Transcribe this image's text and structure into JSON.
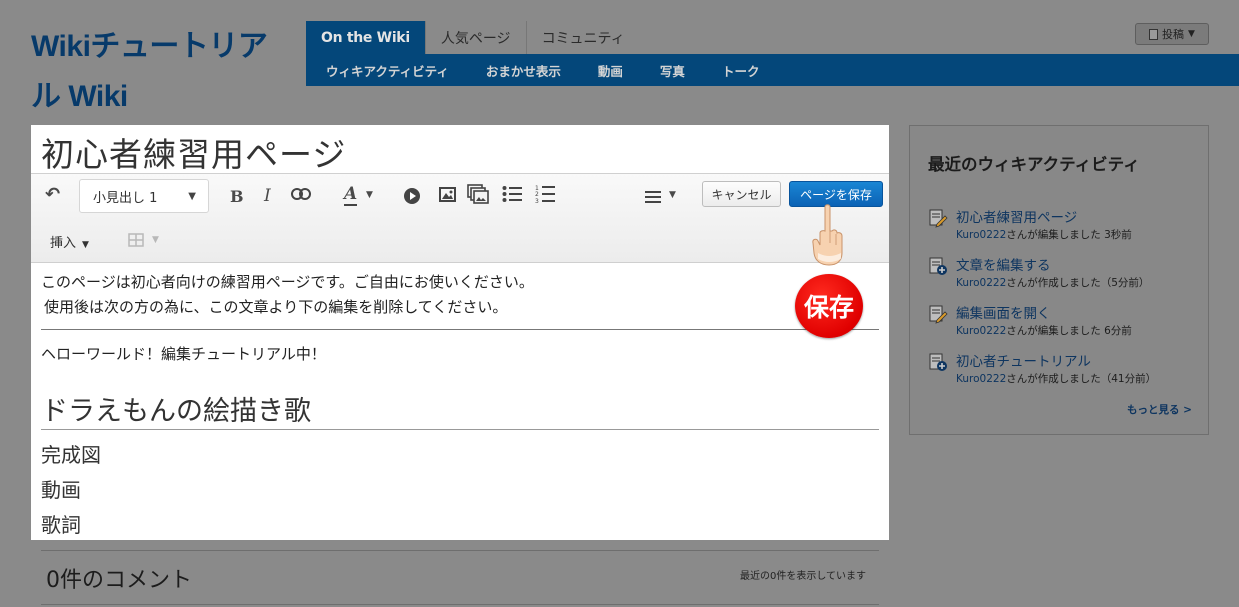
{
  "header": {
    "wiki_title": "Wikiチュートリアル Wiki",
    "tabs": [
      {
        "label": "On the Wiki",
        "active": true
      },
      {
        "label": "人気ページ",
        "active": false
      },
      {
        "label": "コミュニティ",
        "active": false
      }
    ],
    "subnav": [
      "ウィキアクティビティ",
      "おまかせ表示",
      "動画",
      "写真",
      "トーク"
    ],
    "contribute_label": "投稿"
  },
  "editor": {
    "page_title": "初心者練習用ページ",
    "toolbar": {
      "format_select": "小見出し 1",
      "bold": "B",
      "italic": "I",
      "text_color": "A",
      "cancel_label": "キャンセル",
      "save_label": "ページを保存",
      "insert_label": "挿入"
    },
    "content": {
      "paragraph1": "このページは初心者向けの練習用ページです。ご自由にお使いください。",
      "paragraph2": "使用後は次の方の為に、この文章より下の編集を削除してください。",
      "paragraph3": "ヘローワールド！編集チュートリアル中！",
      "heading": "ドラえもんの絵描き歌",
      "sections": [
        "完成図",
        "動画",
        "歌詞"
      ]
    }
  },
  "annotation": {
    "stamp_text": "保存"
  },
  "comments": {
    "title": "0件のコメント",
    "count_text": "最近の0件を表示しています"
  },
  "rail": {
    "title": "最近のウィキアクティビティ",
    "activities": [
      {
        "title": "初心者練習用ページ",
        "user": "Kuro0222",
        "meta": "さんが編集しました 3秒前",
        "icon": "edit-icon"
      },
      {
        "title": "文章を編集する",
        "user": "Kuro0222",
        "meta": "さんが作成しました（5分前）",
        "icon": "new-page-icon"
      },
      {
        "title": "編集画面を開く",
        "user": "Kuro0222",
        "meta": "さんが編集しました 6分前",
        "icon": "edit-icon"
      },
      {
        "title": "初心者チュートリアル",
        "user": "Kuro0222",
        "meta": "さんが作成しました（41分前）",
        "icon": "new-page-icon"
      }
    ],
    "more_label": "もっと見る >"
  },
  "colors": {
    "brand_blue": "#04477a",
    "save_blue": "#0b62b5",
    "stamp_red": "#e00000"
  }
}
